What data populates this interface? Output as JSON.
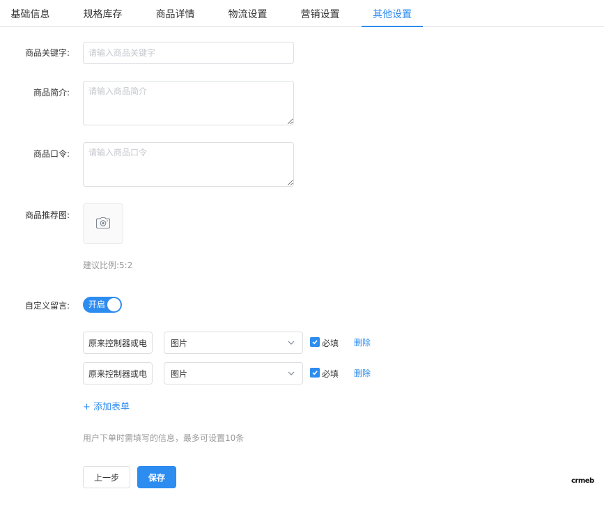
{
  "tabs": [
    {
      "label": "基础信息"
    },
    {
      "label": "规格库存"
    },
    {
      "label": "商品详情"
    },
    {
      "label": "物流设置"
    },
    {
      "label": "营销设置"
    },
    {
      "label": "其他设置"
    }
  ],
  "active_tab": "其他设置",
  "form": {
    "keyword": {
      "label": "商品关键字:",
      "placeholder": "请输入商品关键字",
      "value": ""
    },
    "intro": {
      "label": "商品简介:",
      "placeholder": "请输入商品简介",
      "value": ""
    },
    "token": {
      "label": "商品口令:",
      "placeholder": "请输入商品口令",
      "value": ""
    },
    "recommend_image": {
      "label": "商品推荐图:",
      "hint": "建议比例:5:2",
      "icon": "camera-icon"
    },
    "custom_message": {
      "label": "自定义留言:",
      "switch_text": "开启",
      "enabled": true,
      "rows": [
        {
          "name_value": "原来控制器或电",
          "type_value": "图片",
          "required_label": "必填",
          "required": true,
          "delete_label": "删除"
        },
        {
          "name_value": "原来控制器或电",
          "type_value": "图片",
          "required_label": "必填",
          "required": true,
          "delete_label": "删除"
        }
      ],
      "add_label": "+ 添加表单",
      "note": "用户下单时需填写的信息，最多可设置10条"
    }
  },
  "footer": {
    "prev_label": "上一步",
    "save_label": "保存"
  },
  "brand": {
    "logo_text": "crmeb"
  },
  "colors": {
    "accent": "#2d8cf0",
    "border": "#dcdee2",
    "hint": "#999999"
  }
}
